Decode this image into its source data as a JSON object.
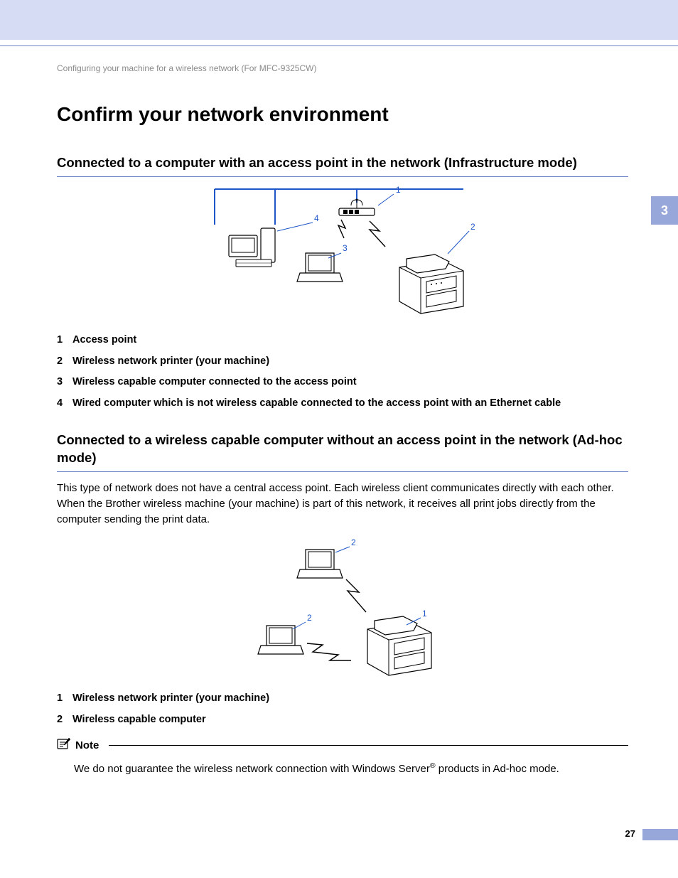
{
  "chapter_tab": "3",
  "breadcrumb": "Configuring your machine for a wireless network (For MFC-9325CW)",
  "h1": "Confirm your network environment",
  "section1": {
    "heading": "Connected to a computer with an access point in the network (Infrastructure mode)",
    "diagram_labels": {
      "l1": "1",
      "l2": "2",
      "l3": "3",
      "l4": "4"
    },
    "legend": [
      {
        "num": "1",
        "text": "Access point"
      },
      {
        "num": "2",
        "text": "Wireless network printer (your machine)"
      },
      {
        "num": "3",
        "text": "Wireless capable computer connected to the access point"
      },
      {
        "num": "4",
        "text": "Wired computer which is not wireless capable connected to the access point with an Ethernet cable"
      }
    ]
  },
  "section2": {
    "heading": "Connected to a wireless capable computer without an access point in the network (Ad-hoc mode)",
    "paragraph": "This type of network does not have a central access point. Each wireless client communicates directly with each other. When the Brother wireless machine (your machine) is part of this network, it receives all print jobs directly from the computer sending the print data.",
    "diagram_labels": {
      "l1": "1",
      "l2a": "2",
      "l2b": "2"
    },
    "legend": [
      {
        "num": "1",
        "text": "Wireless network printer (your machine)"
      },
      {
        "num": "2",
        "text": "Wireless capable computer"
      }
    ]
  },
  "note": {
    "label": "Note",
    "text_pre": "We do not guarantee the wireless network connection with Windows Server",
    "reg": "®",
    "text_post": " products in Ad-hoc mode."
  },
  "page_number": "27"
}
